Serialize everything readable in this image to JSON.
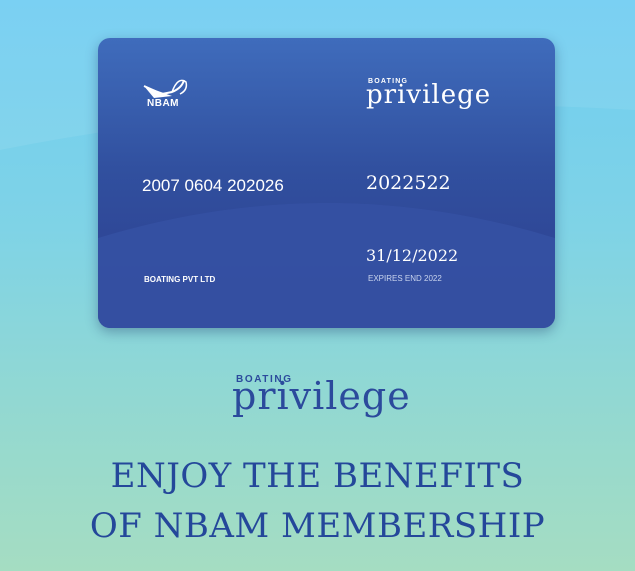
{
  "card": {
    "org_logo_text": "NBAM",
    "brand_small": "BOATING",
    "brand_big": "privilege",
    "card_number": "2007 0604 202026",
    "member_id": "2022522",
    "expiry_date": "31/12/2022",
    "expiry_label": "EXPIRES END 2022",
    "company": "BOATING PVT LTD"
  },
  "brand": {
    "small": "BOATING",
    "big": "privilege"
  },
  "headline": {
    "line1": "ENJOY THE BENEFITS",
    "line2": "OF NBAM MEMBERSHIP"
  },
  "colors": {
    "card_top": "#3f6cbc",
    "card_bottom": "#2c3d8e",
    "headline": "#24479a",
    "bg_top": "#6fcdf2",
    "bg_bottom": "#a5ddc2"
  }
}
